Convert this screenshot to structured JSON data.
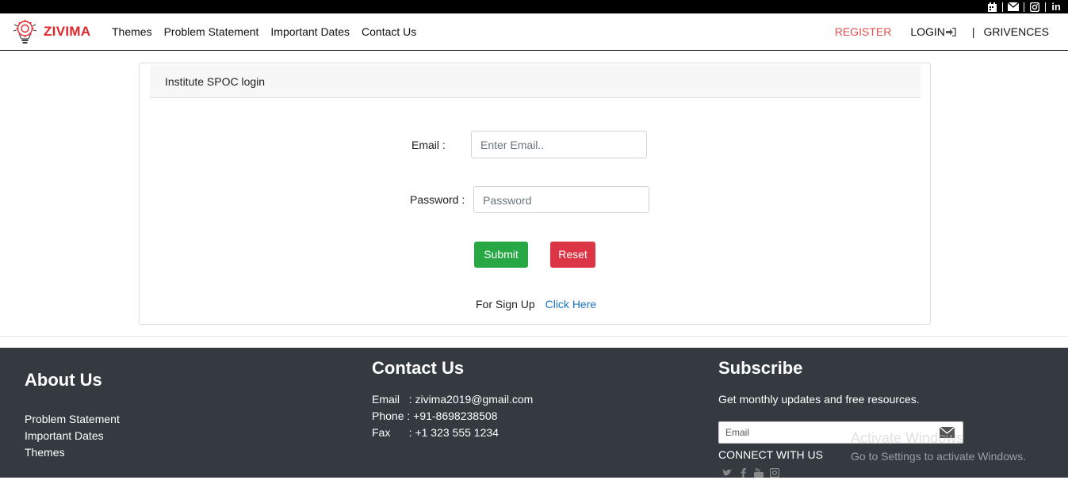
{
  "topbar": {
    "icons": [
      "calendar-icon",
      "envelope-icon",
      "instagram-icon",
      "linkedin-icon"
    ],
    "linkedin_text": "in"
  },
  "navbar": {
    "brand": "ZIVIMA",
    "links": [
      "Themes",
      "Problem Statement",
      "Important Dates",
      "Contact Us"
    ],
    "register": "REGISTER",
    "login": "LOGIN",
    "pipe": "|",
    "grievences": "GRIVENCES",
    "colors": {
      "brand": "#e3242b",
      "register": "#e34f4f"
    }
  },
  "login_card": {
    "header": "Institute SPOC login",
    "email_label": "Email :",
    "email_placeholder": "Enter Email..",
    "password_label": "Password :",
    "password_placeholder": "Password",
    "submit_label": "Submit",
    "reset_label": "Reset",
    "signup_text": "For Sign Up",
    "signup_link": "Click Here",
    "colors": {
      "submit": "#28a745",
      "reset": "#dc3545",
      "link": "#1a73c7"
    }
  },
  "footer": {
    "about": {
      "heading": "About Us",
      "links": [
        "Problem Statement",
        "Important Dates",
        "Themes"
      ]
    },
    "contact": {
      "heading": "Contact Us",
      "email": "Email   : zivima2019@gmail.com",
      "phone": "Phone : +91-8698238508",
      "fax": "Fax      : +1 323 555 1234"
    },
    "subscribe": {
      "heading": "Subscribe",
      "text": "Get monthly updates and free resources.",
      "input_placeholder": "Email",
      "connect": "CONNECT WITH US",
      "social_icons": [
        "twitter-icon",
        "facebook-icon",
        "youtube-icon",
        "instagram-icon"
      ]
    },
    "background": "#343a40"
  },
  "watermark": {
    "line1": "Activate Windows",
    "line2": "Go to Settings to activate Windows."
  }
}
